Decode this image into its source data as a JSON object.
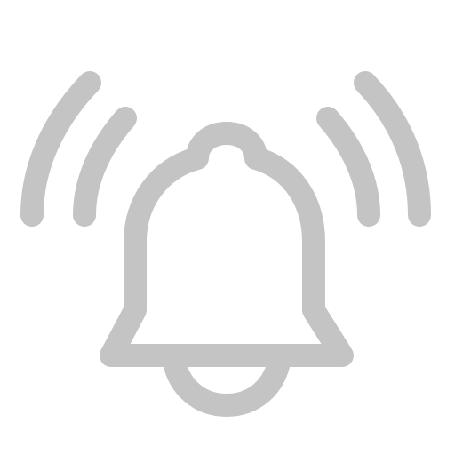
{
  "icon": {
    "name": "ringing-bell-icon",
    "stroke_color": "#c4c4c4",
    "background_color": "#ffffff"
  }
}
